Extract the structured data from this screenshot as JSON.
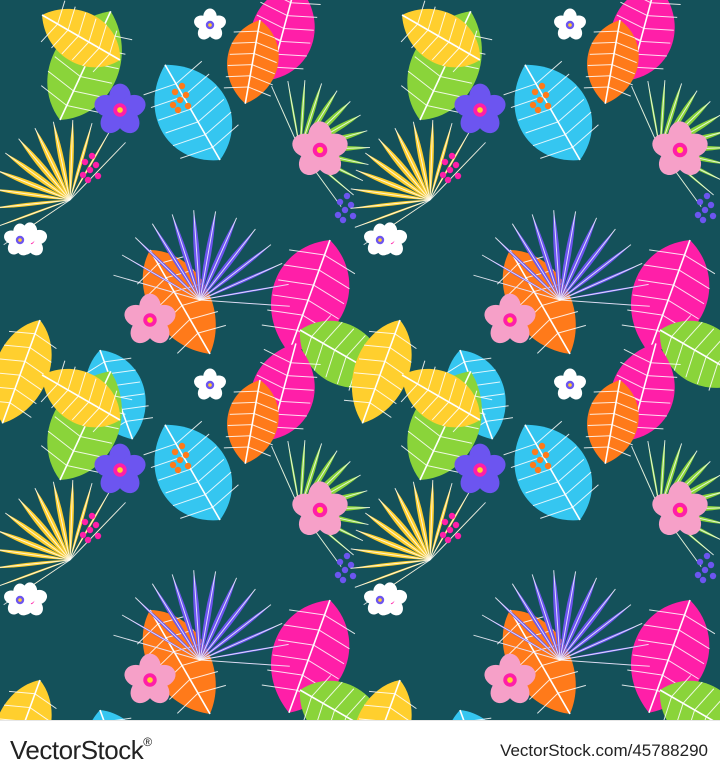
{
  "image": {
    "background_color": "#14515a",
    "palette": [
      "#ff1fa8",
      "#35c6f0",
      "#8ad43a",
      "#ffcf2e",
      "#ff7a1a",
      "#6c55f0",
      "#f6a0c8",
      "#ffffff"
    ]
  },
  "watermark": {
    "brand": "VectorStock",
    "trademark": "®",
    "stock_id": "VectorStock.com/45788290"
  }
}
